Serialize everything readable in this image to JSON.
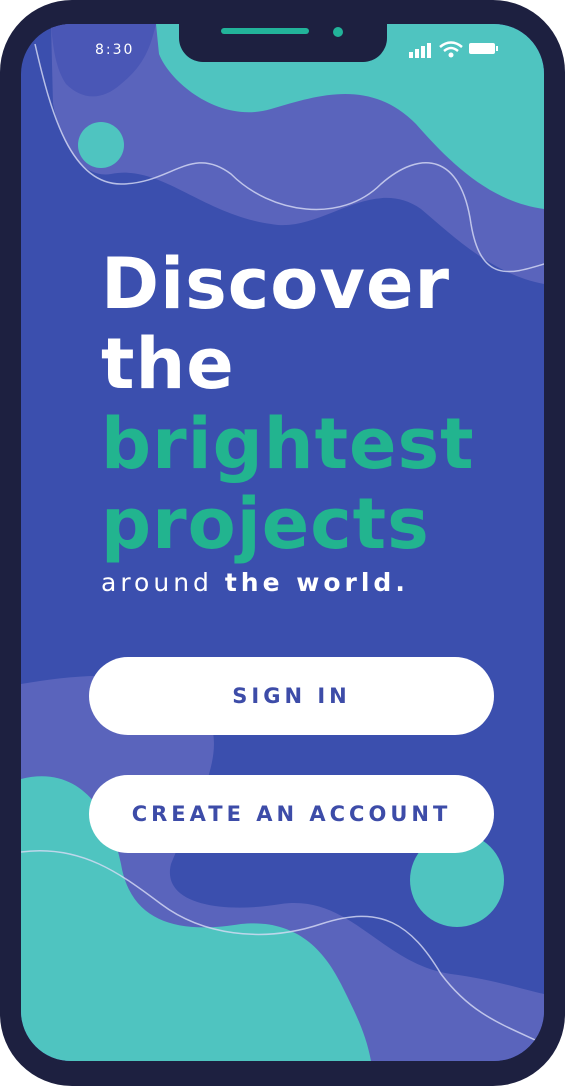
{
  "status_bar": {
    "time": "8:30",
    "icons": [
      "signal-icon",
      "wifi-icon",
      "battery-icon"
    ]
  },
  "headline": {
    "line1": "Discover",
    "line2": "the",
    "line3": "brightest",
    "line4": "projects"
  },
  "tagline": {
    "regular": "around ",
    "bold": "the world."
  },
  "buttons": {
    "sign_in": "SIGN IN",
    "create_account": "CREATE AN ACCOUNT"
  },
  "colors": {
    "screen_background": "#3b4fae",
    "phone_frame": "#1d2040",
    "accent_teal": "#4fc4c0",
    "accent_purple": "#5a64bc",
    "headline_green": "#22b48f",
    "button_text": "#3d4ca8"
  }
}
